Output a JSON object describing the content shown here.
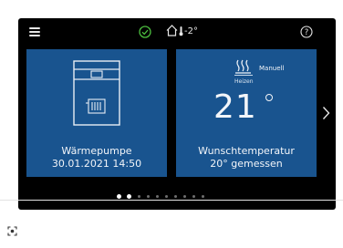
{
  "status_bar": {
    "outdoor_temp": "-2°",
    "icons": [
      "menu-icon",
      "check-circle-icon",
      "house-icon",
      "thermometer-icon",
      "help-icon"
    ]
  },
  "tiles": {
    "heat_pump": {
      "name": "Wärmepumpe",
      "datetime": "30.01.2021 14:50",
      "icon": "heat-pump-icon"
    },
    "room_temp": {
      "mode": "Manuell",
      "state": "Heizen",
      "value": "21",
      "caption": "Wunschtemperatur",
      "measured": "20° gemessen",
      "icon": "heating-waves-icon"
    }
  },
  "pager": {
    "count": 10,
    "active": 1
  },
  "colors": {
    "tile_bg": "#19548f",
    "screen_bg": "#000000",
    "ok_green": "#4cbf3f"
  }
}
